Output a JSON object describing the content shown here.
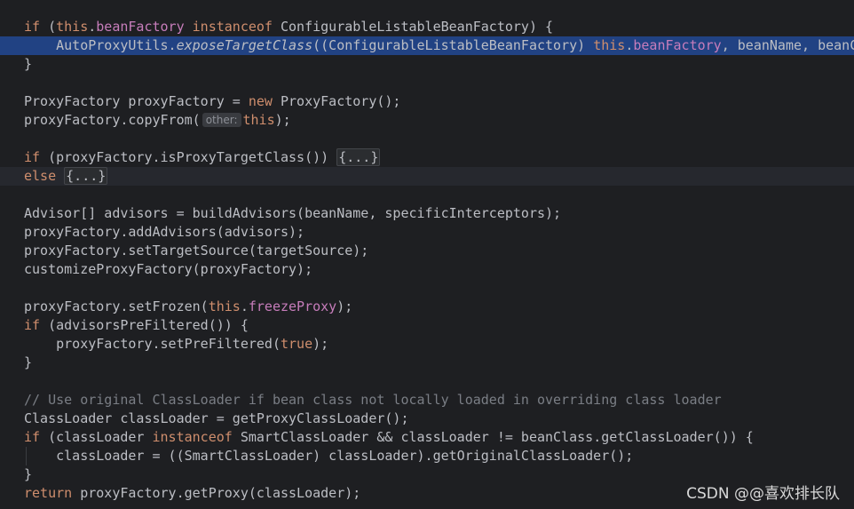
{
  "editor": {
    "lines": {
      "l01": {
        "a": "if",
        "b": " (",
        "c": "this",
        "d": ".",
        "e": "beanFactory",
        "f": " ",
        "g": "instanceof",
        "h": " ConfigurableListableBeanFactory) {"
      },
      "l02": {
        "a": "    AutoProxyUtils.",
        "b": "exposeTargetClass",
        "c": "((ConfigurableListableBeanFactory) ",
        "d": "this",
        "e": ".",
        "f": "beanFactory",
        "g": ", beanName, beanClass);"
      },
      "l03": {
        "a": "}"
      },
      "l05": {
        "a": "ProxyFactory proxyFactory = ",
        "b": "new",
        "c": " ProxyFactory();"
      },
      "l06": {
        "a": "proxyFactory.copyFrom(",
        "hint": "other:",
        "b": "this",
        "c": ");"
      },
      "l08": {
        "a": "if",
        "b": " (proxyFactory.isProxyTargetClass()) ",
        "fold": "{...}"
      },
      "l09": {
        "a": "else",
        "b": " ",
        "fold": "{...}"
      },
      "l11": {
        "a": "Advisor[] advisors = buildAdvisors(beanName, specificInterceptors);"
      },
      "l12": {
        "a": "proxyFactory.addAdvisors(advisors);"
      },
      "l13": {
        "a": "proxyFactory.setTargetSource(targetSource);"
      },
      "l14": {
        "a": "customizeProxyFactory(proxyFactory);"
      },
      "l16": {
        "a": "proxyFactory.setFrozen(",
        "b": "this",
        "c": ".",
        "d": "freezeProxy",
        "e": ");"
      },
      "l17": {
        "a": "if",
        "b": " (advisorsPreFiltered()) {"
      },
      "l18": {
        "a": "    proxyFactory.setPreFiltered(",
        "b": "true",
        "c": ");"
      },
      "l19": {
        "a": "}"
      },
      "l21": {
        "a": "// Use original ClassLoader if bean class not locally loaded in overriding class loader"
      },
      "l22": {
        "a": "ClassLoader classLoader = getProxyClassLoader();"
      },
      "l23": {
        "a": "if",
        "b": " (classLoader ",
        "c": "instanceof",
        "d": " SmartClassLoader && classLoader != beanClass.getClassLoader()) {"
      },
      "l24": {
        "a": "    classLoader = ((SmartClassLoader) classLoader).getOriginalClassLoader();"
      },
      "l25": {
        "a": "}"
      },
      "l26": {
        "a": "return",
        "b": " proxyFactory.getProxy(classLoader);"
      }
    }
  },
  "watermark": {
    "text": "CSDN @@喜欢排长队"
  },
  "colors": {
    "background": "#1e1f22",
    "keyword": "#cf8e6d",
    "field": "#c77dbb",
    "comment": "#7a7e85",
    "plain": "#bcbec4",
    "current_line": "#214283"
  }
}
